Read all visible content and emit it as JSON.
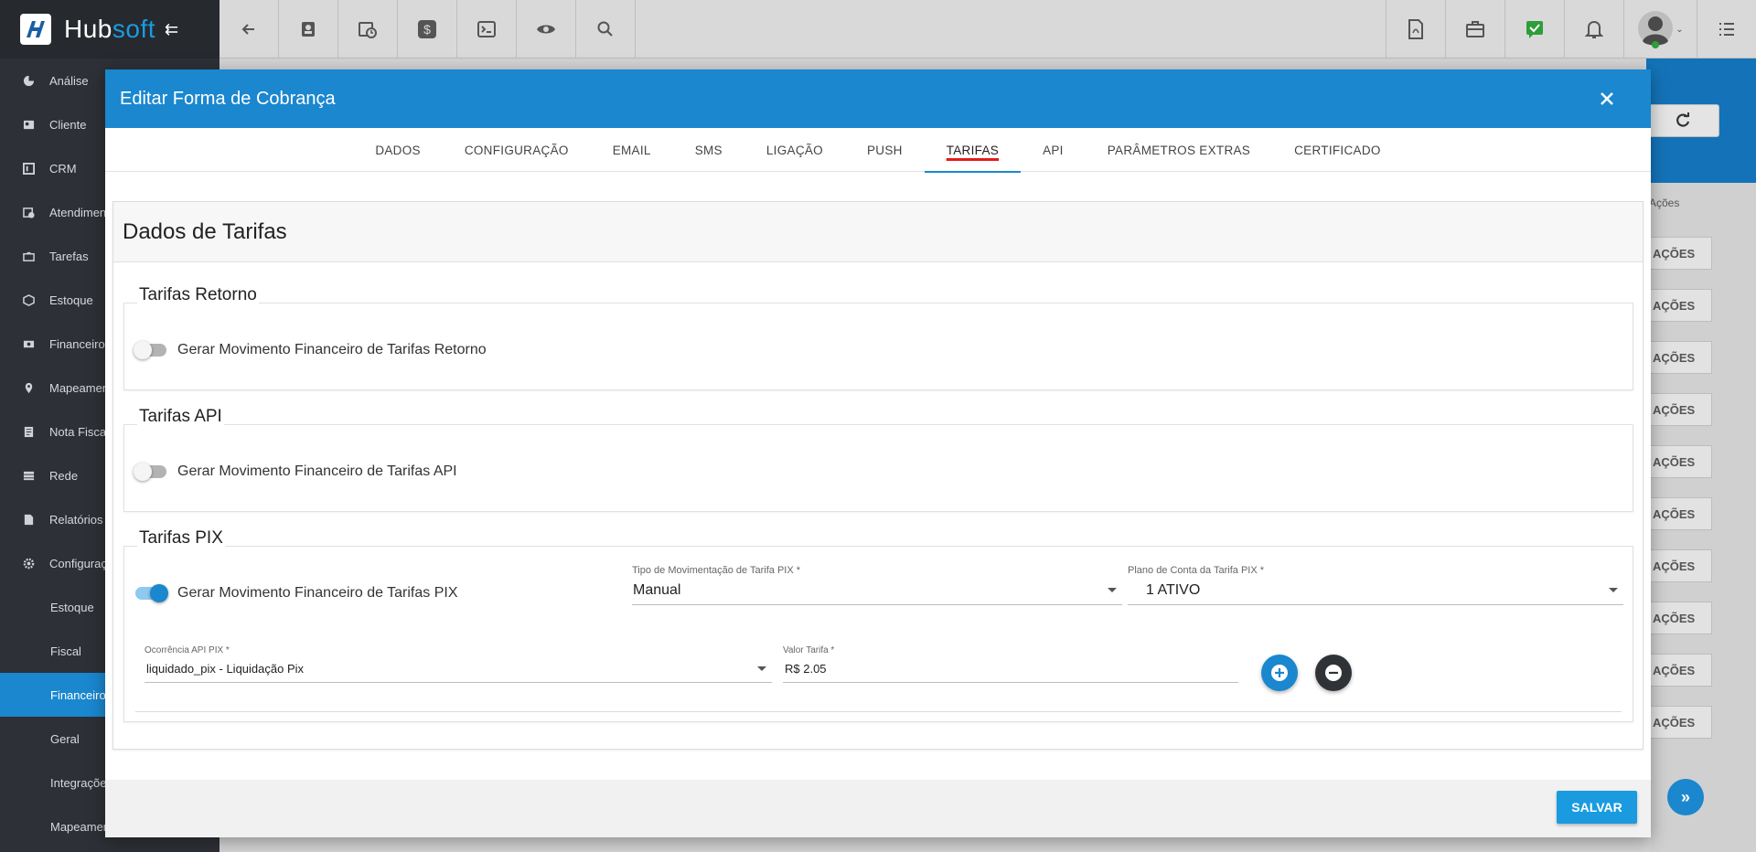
{
  "app": {
    "logo_hub": "Hub",
    "logo_soft": "soft"
  },
  "sidebar": {
    "items": [
      {
        "label": "Análise",
        "icon": "pie-chart-icon"
      },
      {
        "label": "Cliente",
        "icon": "contact-card-icon"
      },
      {
        "label": "CRM",
        "icon": "board-icon"
      },
      {
        "label": "Atendimentos",
        "icon": "calendar-clock-icon"
      },
      {
        "label": "Tarefas",
        "icon": "briefcase-icon"
      },
      {
        "label": "Estoque",
        "icon": "box-icon"
      },
      {
        "label": "Financeiro",
        "icon": "money-icon"
      },
      {
        "label": "Mapeamento",
        "icon": "map-pin-icon"
      },
      {
        "label": "Nota Fiscal",
        "icon": "invoice-icon"
      },
      {
        "label": "Rede",
        "icon": "network-icon"
      },
      {
        "label": "Relatórios",
        "icon": "report-icon"
      },
      {
        "label": "Configurações",
        "icon": "gear-icon"
      }
    ],
    "sub_items": [
      {
        "label": "Estoque"
      },
      {
        "label": "Fiscal"
      },
      {
        "label": "Financeiro",
        "active": true
      },
      {
        "label": "Geral"
      },
      {
        "label": "Integrações"
      },
      {
        "label": "Mapeamento"
      }
    ]
  },
  "background": {
    "acoes_header": "Ações",
    "acoes_button": "AÇÕES"
  },
  "modal": {
    "title": "Editar Forma de Cobrança",
    "tabs": [
      {
        "label": "DADOS"
      },
      {
        "label": "CONFIGURAÇÃO"
      },
      {
        "label": "EMAIL"
      },
      {
        "label": "SMS"
      },
      {
        "label": "LIGAÇÃO"
      },
      {
        "label": "PUSH"
      },
      {
        "label": "TARIFAS",
        "active": true
      },
      {
        "label": "API"
      },
      {
        "label": "PARÂMETROS EXTRAS"
      },
      {
        "label": "CERTIFICADO"
      }
    ],
    "card_title": "Dados de Tarifas",
    "retorno": {
      "legend": "Tarifas Retorno",
      "switch_label": "Gerar Movimento Financeiro de Tarifas Retorno",
      "switch_on": false
    },
    "api": {
      "legend": "Tarifas API",
      "switch_label": "Gerar Movimento Financeiro de Tarifas API",
      "switch_on": false
    },
    "pix": {
      "legend": "Tarifas PIX",
      "switch_label": "Gerar Movimento Financeiro de Tarifas PIX",
      "switch_on": true,
      "tipo_label": "Tipo de Movimentação de Tarifa PIX *",
      "tipo_value": "Manual",
      "plano_label": "Plano de Conta da Tarifa PIX *",
      "plano_value": "1 ATIVO",
      "ocorrencia_label": "Ocorrência API PIX *",
      "ocorrencia_value": "liquidado_pix - Liquidação Pix",
      "valor_label": "Valor Tarifa *",
      "valor_value": "R$ 2.05"
    },
    "save_label": "SALVAR"
  },
  "colors": {
    "primary": "#1a87cf",
    "sidebar": "#2d3036",
    "tab_underline_highlight": "#e41b1b"
  }
}
